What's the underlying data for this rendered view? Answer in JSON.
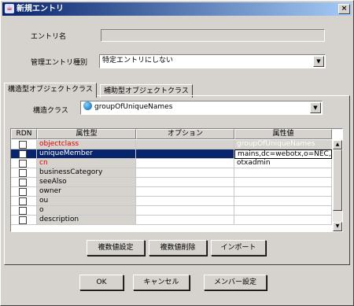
{
  "window": {
    "title": "新規エントリ",
    "close": "×"
  },
  "form": {
    "entry_name_label": "エントリ名",
    "entry_name_value": "",
    "manage_type_label": "管理エントリ種別",
    "manage_type_value": "特定エントリにしない"
  },
  "tabs": [
    {
      "label": "構造型オブジェクトクラス"
    },
    {
      "label": "補助型オブジェクトクラス"
    }
  ],
  "structural": {
    "label": "構造クラス",
    "value": "groupOfUniqueNames"
  },
  "table": {
    "headers": [
      "RDN",
      "属性型",
      "オプション",
      "属性値"
    ],
    "rows": [
      {
        "type": "objectclass",
        "option": "",
        "value": "groupOfUniqueNames"
      },
      {
        "type": "uniqueMember",
        "option": "",
        "value": "mains,dc=webotx,o=NEC,c=JP"
      },
      {
        "type": "cn",
        "option": "",
        "value": "otxadmin"
      },
      {
        "type": "businessCategory",
        "option": "",
        "value": ""
      },
      {
        "type": "seeAlso",
        "option": "",
        "value": ""
      },
      {
        "type": "owner",
        "option": "",
        "value": ""
      },
      {
        "type": "ou",
        "option": "",
        "value": ""
      },
      {
        "type": "o",
        "option": "",
        "value": ""
      },
      {
        "type": "description",
        "option": "",
        "value": ""
      }
    ]
  },
  "table_buttons": {
    "multi_set": "複数値設定",
    "multi_delete": "複数値削除",
    "import": "インポート"
  },
  "footer_buttons": {
    "ok": "OK",
    "cancel": "キャンセル",
    "member": "メンバー設定"
  },
  "colors": {
    "required": "#e00000",
    "selection": "#08246b",
    "titlebar": "#08246b"
  }
}
